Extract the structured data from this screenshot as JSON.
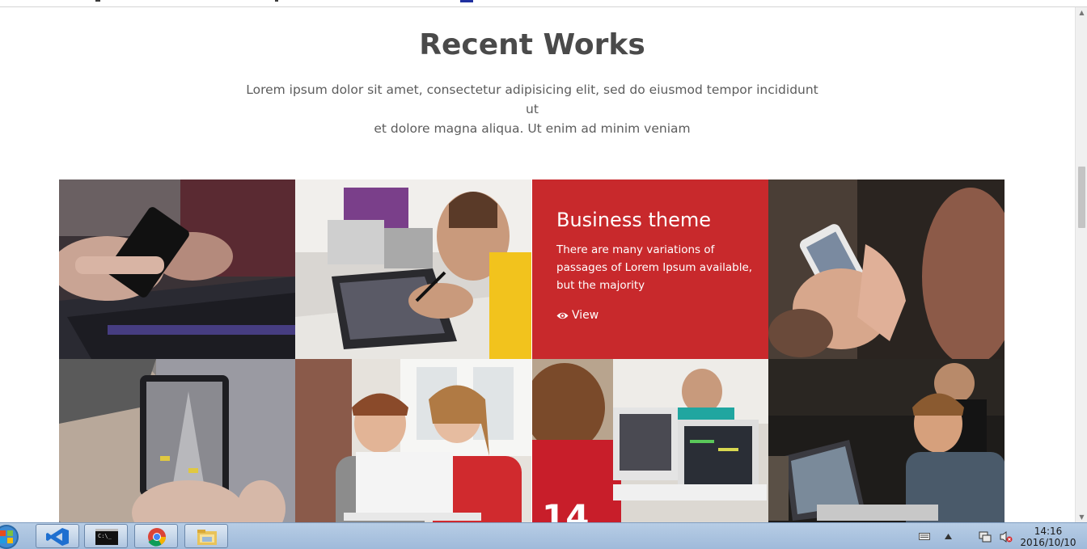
{
  "section": {
    "title": "Recent Works",
    "description_line1": "Lorem ipsum dolor sit amet, consectetur adipisicing elit, sed do eiusmod tempor incididunt ut",
    "description_line2": "et dolore magna aliqua. Ut enim ad minim veniam"
  },
  "portfolio": {
    "items": [
      {
        "photo": "hands holding smartphone over laptop"
      },
      {
        "photo": "man drawing on tablet with stylus"
      },
      {
        "photo": "business theme overlay"
      },
      {
        "photo": "hands holding white smartphone"
      },
      {
        "photo": "woman holding phone with city street"
      },
      {
        "photo": "two children with laptop"
      },
      {
        "photo": "kids coding on laptops"
      },
      {
        "photo": "man working at laptop"
      }
    ],
    "overlay": {
      "title": "Business theme",
      "text": "There are many variations of passages of Lorem Ipsum available, but the majority",
      "view_label": "View",
      "color": "#c8292c"
    }
  },
  "taskbar": {
    "apps": [
      "visual-studio-icon",
      "command-prompt-icon",
      "chrome-icon",
      "file-explorer-icon"
    ],
    "time": "14:16",
    "date": "2016/10/10"
  }
}
